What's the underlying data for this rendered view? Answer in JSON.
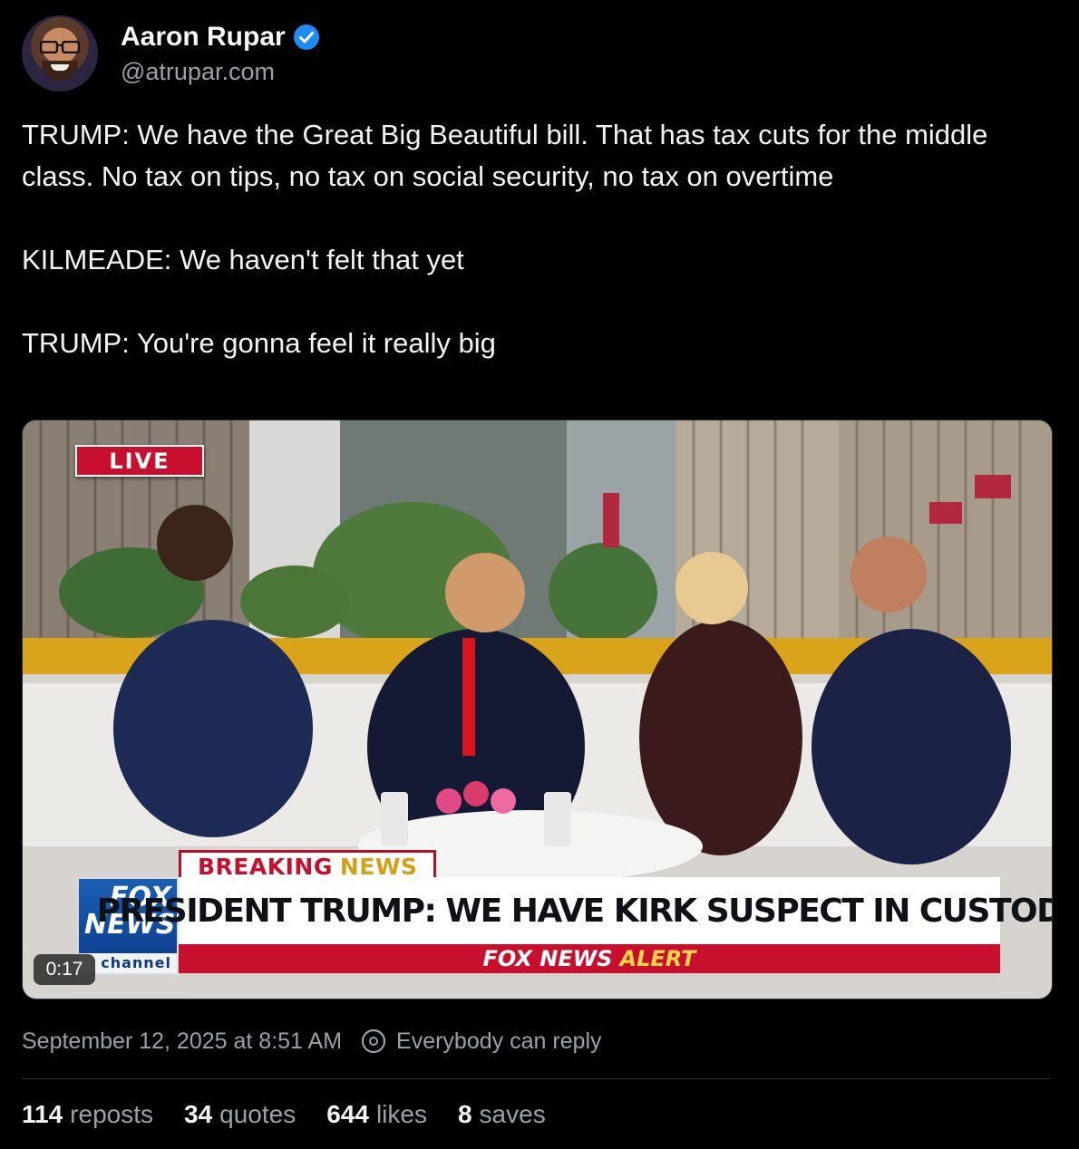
{
  "author": {
    "name": "Aaron Rupar",
    "handle": "@atrupar.com",
    "verified": true
  },
  "post": {
    "paragraphs": [
      "TRUMP: We have the Great Big Beautiful bill. That has tax cuts for the middle class. No tax on tips, no tax on social security, no tax on overtime",
      "KILMEADE: We haven't felt that yet",
      "TRUMP: You're gonna feel it really big"
    ]
  },
  "video": {
    "live_label": "LIVE",
    "breaking_word1": "BREAKING",
    "breaking_word2": "NEWS",
    "headline": "PRESIDENT TRUMP: WE HAVE KIRK SUSPECT IN CUSTODY",
    "alert_word1": "FOX NEWS",
    "alert_word2": "ALERT",
    "logo_line1": "FOX",
    "logo_line2": "NEWS",
    "logo_line3": "channel",
    "duration": "0:17"
  },
  "meta": {
    "date": "September 12, 2025 at 8:51 AM",
    "reply_setting": "Everybody can reply",
    "reply_icon": "reply-scope-icon"
  },
  "stats": [
    {
      "count": "114",
      "label": "reposts"
    },
    {
      "count": "34",
      "label": "quotes"
    },
    {
      "count": "644",
      "label": "likes"
    },
    {
      "count": "8",
      "label": "saves"
    }
  ],
  "colors": {
    "background": "#000000",
    "text": "#f1f3f5",
    "muted": "#9aa1a8",
    "verified": "#1d8cf8",
    "fox_red": "#c8102e",
    "fox_blue": "#0b3a8a"
  }
}
